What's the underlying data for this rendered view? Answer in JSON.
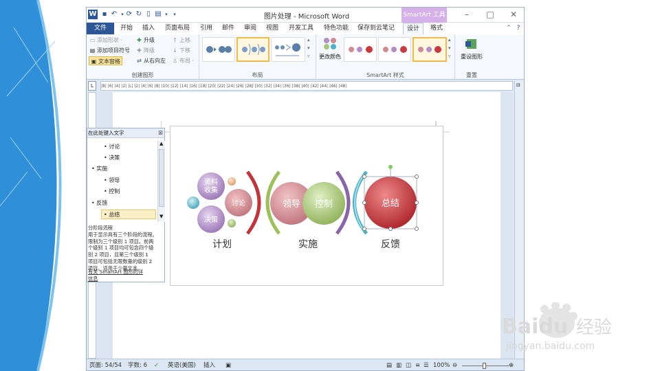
{
  "window": {
    "title": "图片处理 - Microsoft Word",
    "app_icon": "W",
    "contextual_tab": "SmartArt 工具",
    "controls": [
      "–",
      "□",
      "✕"
    ]
  },
  "quick_access": [
    "save-icon",
    "undo-icon",
    "redo-icon",
    "repeat-icon",
    "new-doc-icon",
    "table-icon",
    "customize-icon"
  ],
  "tabs": [
    "文件",
    "开始",
    "插入",
    "页面布局",
    "引用",
    "邮件",
    "审阅",
    "视图",
    "开发工具",
    "特色功能",
    "保存到云笔记",
    "设计",
    "格式"
  ],
  "active_tab": "设计",
  "ribbon": {
    "create": {
      "label": "创建图形",
      "add_shape": "添加形状 ·",
      "add_bullet": "添加项目符号",
      "text_pane": "文本窗格",
      "promote": "升级",
      "demote": "降级",
      "rtl": "从右向左",
      "move_up": "上移",
      "move_down": "下移",
      "layout_btn": "布局 ·"
    },
    "layouts": {
      "label": "布局"
    },
    "styles": {
      "label": "SmartArt 样式",
      "change_colors": "更改颜色"
    },
    "reset": {
      "label": "重置",
      "reset_graphic": "重设图形"
    }
  },
  "ruler_text": "|8| |6| |4| |2| |L| |2| |4| |6| |8| |10| |12| |14| |16| |18| |20| |22| |24| |26| |28| |30| |32| |34| |36| |38| |40| |42| |44| |46| |48|",
  "text_pane": {
    "title": "在此处键入文字",
    "close": "☒",
    "items": [
      {
        "text": "讨论",
        "level": 2
      },
      {
        "text": "决策",
        "level": 2
      },
      {
        "text": "实施",
        "level": 1
      },
      {
        "text": "领导",
        "level": 2
      },
      {
        "text": "控制",
        "level": 2
      },
      {
        "text": "反馈",
        "level": 1
      },
      {
        "text": "总结",
        "level": 2
      }
    ],
    "selected_index": 6,
    "desc_title": "分阶段流程",
    "desc_lines": [
      "用于显示具有三个阶段的流程。",
      "限制为三个级别 1 项目。前两",
      "个级别 1 项目均可包含四个级",
      "别 2 项目，且第三个级别 1",
      "项目可包括无限数量的级别 2",
      "项目。适用于少量文本。"
    ],
    "link_lines": [
      "有关 SmartArt 图形的详",
      "信息"
    ]
  },
  "smartart": {
    "phases": [
      {
        "label": "计划",
        "items": [
          "资料收集",
          "讨论",
          "决策"
        ]
      },
      {
        "label": "实施",
        "items": [
          "领导",
          "控制"
        ]
      },
      {
        "label": "反馈",
        "items": [
          "总结"
        ]
      }
    ],
    "bubble1_lines": [
      "资料",
      "收集"
    ]
  },
  "status": {
    "page": "页面: 54/54",
    "words": "字数: 6",
    "language": "英语(美国)",
    "mode": "插入",
    "zoom": "100%"
  },
  "watermark": {
    "brand": "Baidu",
    "cn": "经验",
    "url": "jingyan.baidu.com"
  },
  "colors": {
    "file_tab": "#2b5797",
    "contextual": "#d6b0e8",
    "ribbon_bg": "#f5f8fd",
    "highlight": "#fde49b",
    "purple": "#b38cc8",
    "rose": "#d08a92",
    "green": "#a8c77a",
    "red": "#c83a3e",
    "teal": "#4ab3c9",
    "arc_red": "#c0343a"
  }
}
